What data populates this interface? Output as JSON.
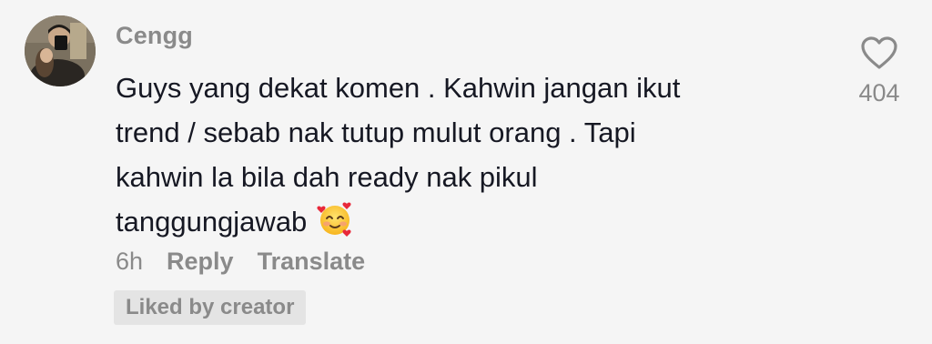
{
  "comment": {
    "username": "Cengg",
    "text_lines": [
      "Guys yang dekat komen . Kahwin jangan ikut",
      "trend / sebab nak tutup mulut orang . Tapi",
      "kahwin la bila dah ready nak pikul",
      "tanggungjawab"
    ],
    "emoji": "smiling-face-with-hearts",
    "time": "6h",
    "reply_label": "Reply",
    "translate_label": "Translate",
    "badge": "Liked by creator",
    "like_count": "404"
  },
  "colors": {
    "background": "#f5f5f5",
    "text": "#161823",
    "muted": "#8a8a8a",
    "badge_bg": "#e4e4e4"
  }
}
